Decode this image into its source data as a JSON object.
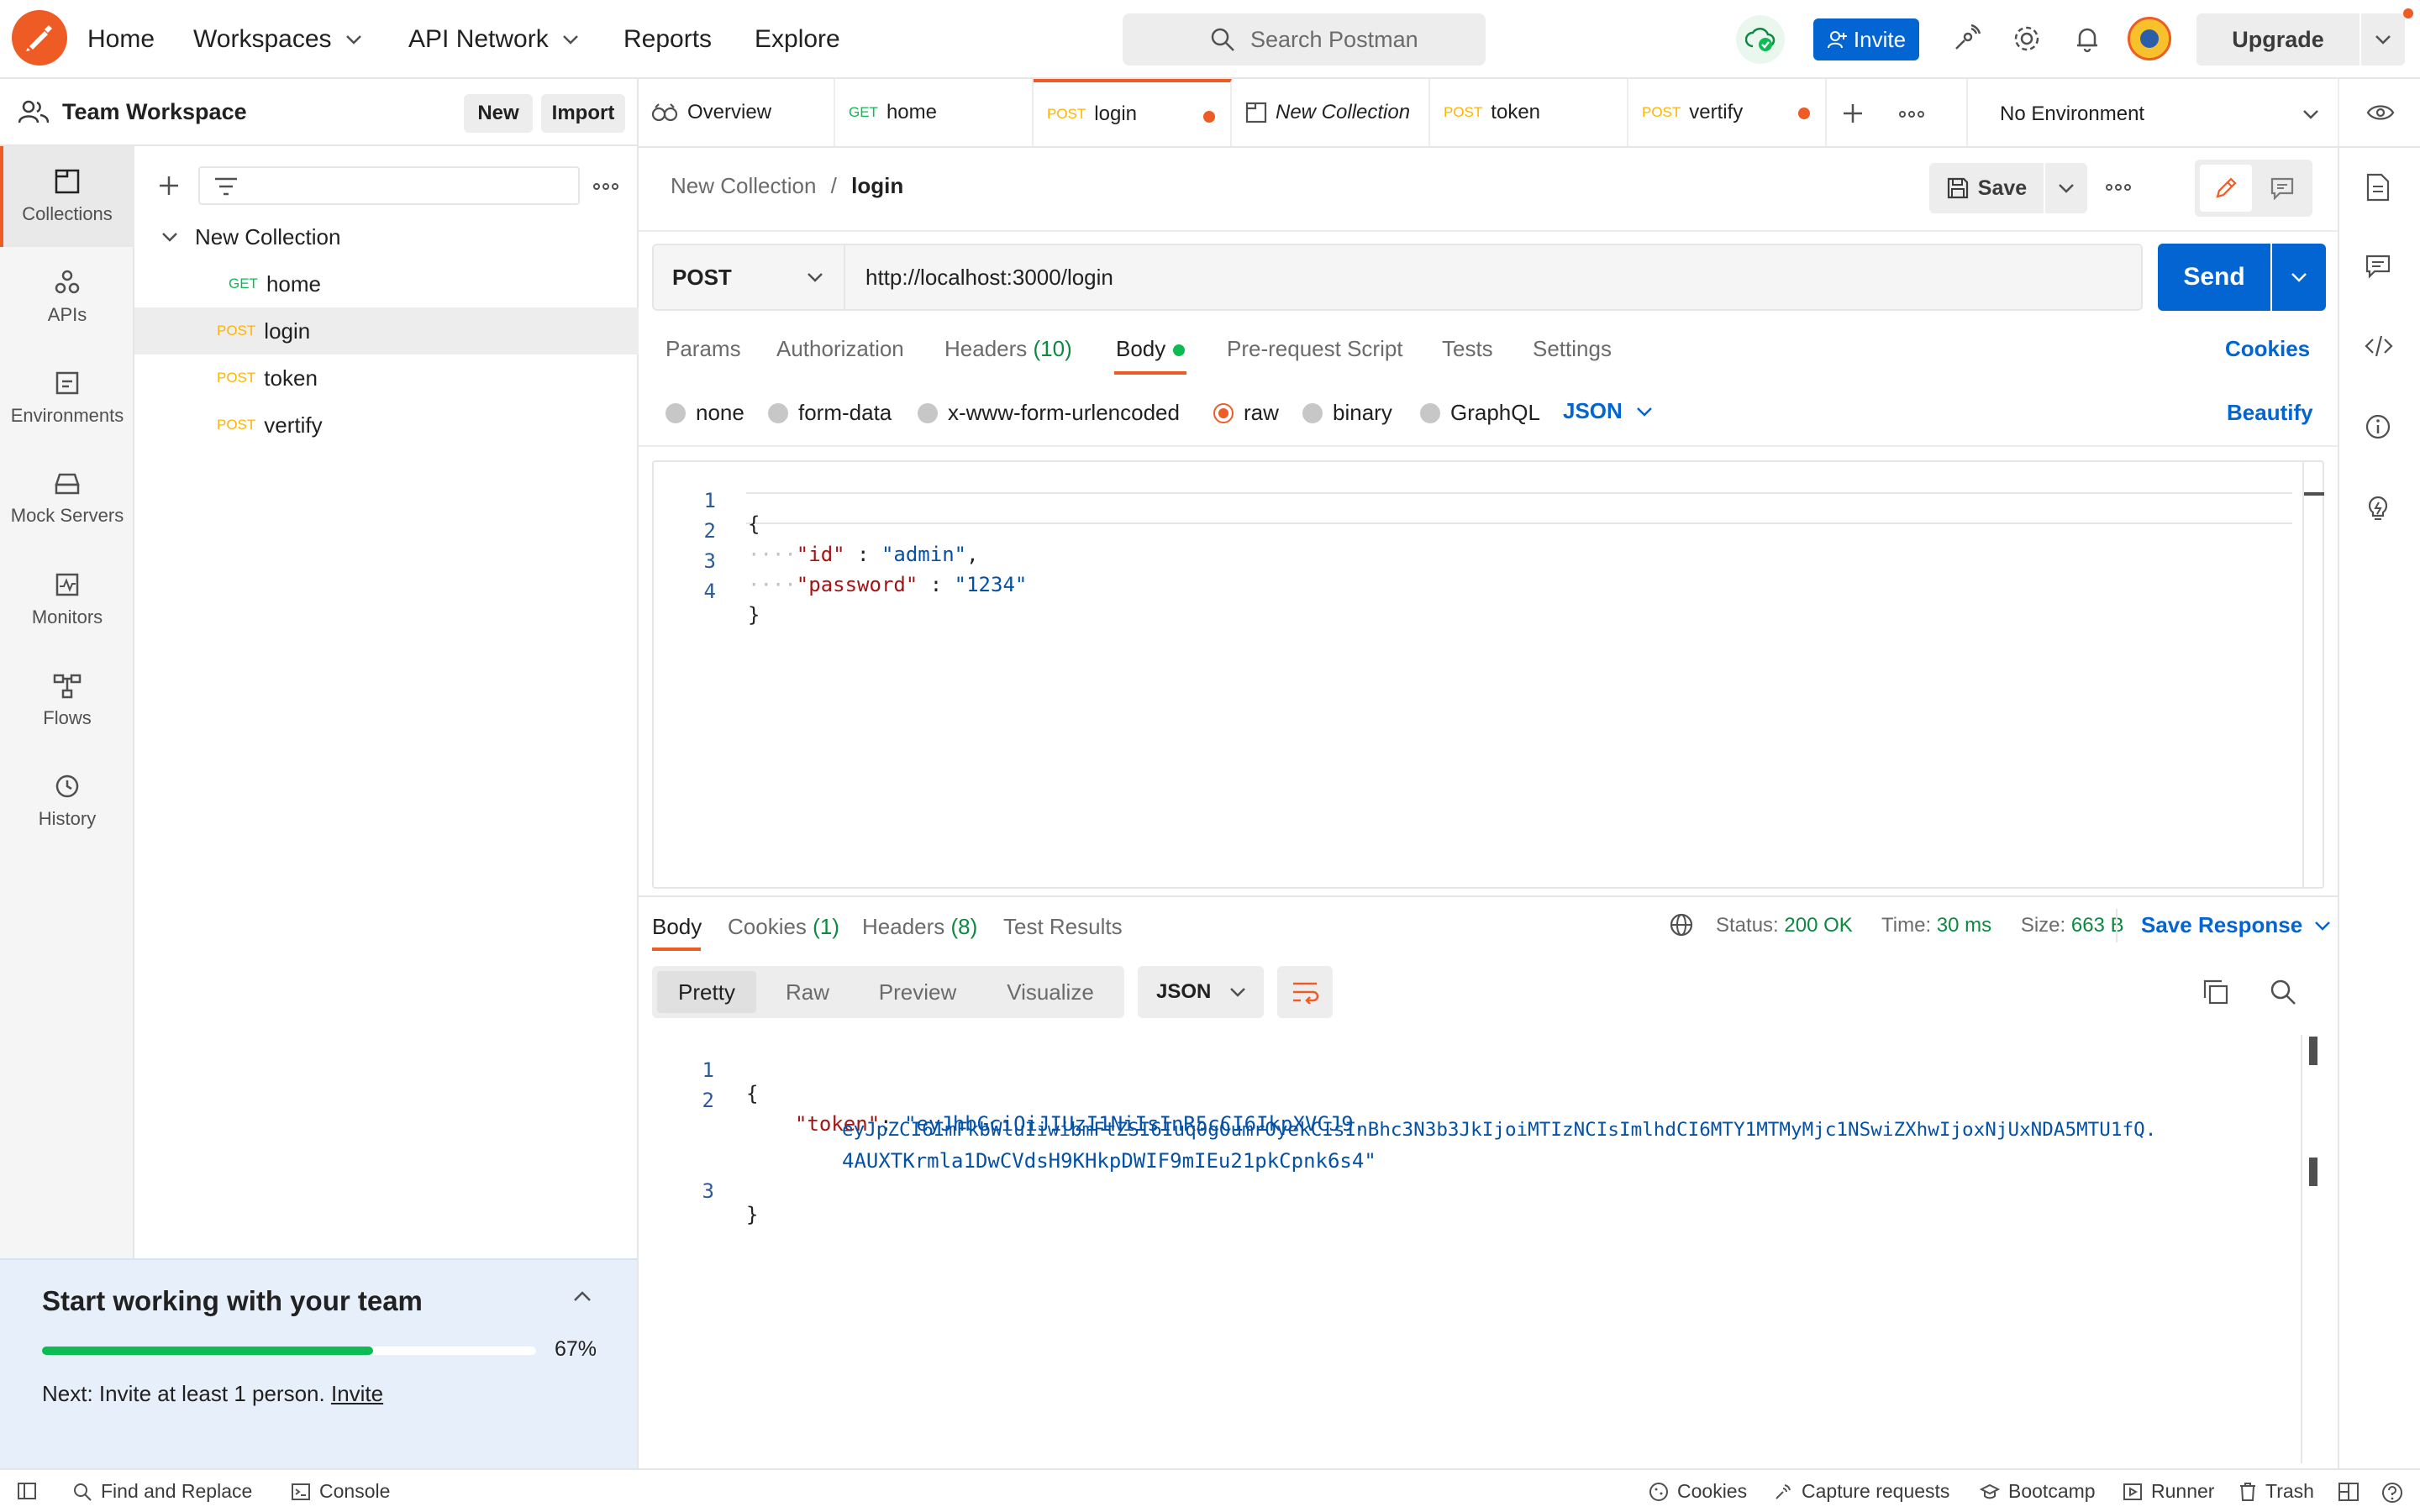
{
  "app": {
    "brand_color": "#ef5b25",
    "accent_color": "#0265d2",
    "success_color": "#0cbb52"
  },
  "topbar": {
    "nav": [
      {
        "label": "Home",
        "has_dropdown": false
      },
      {
        "label": "Workspaces",
        "has_dropdown": true
      },
      {
        "label": "API Network",
        "has_dropdown": true
      },
      {
        "label": "Reports",
        "has_dropdown": false
      },
      {
        "label": "Explore",
        "has_dropdown": false
      }
    ],
    "search_placeholder": "Search Postman",
    "invite_label": "Invite",
    "upgrade_label": "Upgrade",
    "icons": [
      "cloud-sync-icon",
      "satellite-icon",
      "gear-icon",
      "bell-icon",
      "avatar"
    ]
  },
  "workspace": {
    "title": "Team Workspace",
    "new_label": "New",
    "import_label": "Import"
  },
  "rail": {
    "items": [
      {
        "label": "Collections",
        "icon": "collections-icon",
        "active": true
      },
      {
        "label": "APIs",
        "icon": "apis-icon",
        "active": false
      },
      {
        "label": "Environments",
        "icon": "environments-icon",
        "active": false
      },
      {
        "label": "Mock Servers",
        "icon": "mock-servers-icon",
        "active": false
      },
      {
        "label": "Monitors",
        "icon": "monitors-icon",
        "active": false
      },
      {
        "label": "Flows",
        "icon": "flows-icon",
        "active": false
      },
      {
        "label": "History",
        "icon": "history-icon",
        "active": false
      }
    ]
  },
  "sidebar": {
    "collection_name": "New Collection",
    "requests": [
      {
        "method": "GET",
        "name": "home",
        "active": false
      },
      {
        "method": "POST",
        "name": "login",
        "active": true
      },
      {
        "method": "POST",
        "name": "token",
        "active": false
      },
      {
        "method": "POST",
        "name": "vertify",
        "active": false
      }
    ]
  },
  "onboarding": {
    "title": "Start working with your team",
    "progress_percent": 67,
    "progress_label": "67%",
    "next_text": "Next: Invite at least 1 person.",
    "next_link": "Invite"
  },
  "tabs": {
    "items": [
      {
        "method": "",
        "label": "Overview",
        "icon": "overview-icon",
        "unsaved": false,
        "active": false,
        "italic": false
      },
      {
        "method": "GET",
        "label": "home",
        "unsaved": false,
        "active": false,
        "italic": false
      },
      {
        "method": "POST",
        "label": "login",
        "unsaved": true,
        "active": true,
        "italic": false
      },
      {
        "method": "",
        "label": "New Collection",
        "icon": "collection-icon",
        "unsaved": false,
        "active": false,
        "italic": true
      },
      {
        "method": "POST",
        "label": "token",
        "unsaved": false,
        "active": false,
        "italic": false
      },
      {
        "method": "POST",
        "label": "vertify",
        "unsaved": true,
        "active": false,
        "italic": false
      }
    ],
    "environment": "No Environment"
  },
  "request": {
    "breadcrumb_parent": "New Collection",
    "breadcrumb_sep": "/",
    "breadcrumb_current": "login",
    "save_label": "Save",
    "method": "POST",
    "url": "http://localhost:3000/login",
    "send_label": "Send",
    "tabs": [
      {
        "label": "Params",
        "count": ""
      },
      {
        "label": "Authorization",
        "count": ""
      },
      {
        "label": "Headers",
        "count": "(10)"
      },
      {
        "label": "Body",
        "count": ""
      },
      {
        "label": "Pre-request Script",
        "count": ""
      },
      {
        "label": "Tests",
        "count": ""
      },
      {
        "label": "Settings",
        "count": ""
      }
    ],
    "active_tab": "Body",
    "cookies_label": "Cookies",
    "body_types": [
      "none",
      "form-data",
      "x-www-form-urlencoded",
      "raw",
      "binary",
      "GraphQL"
    ],
    "selected_body_type": "raw",
    "raw_format": "JSON",
    "beautify_label": "Beautify",
    "body_lines": [
      {
        "num": "1",
        "indent": "",
        "key": "",
        "sep": "",
        "value": "",
        "tail": "{"
      },
      {
        "num": "2",
        "indent": "····",
        "key": "\"id\"",
        "sep": " : ",
        "value": "\"admin\"",
        "tail": ","
      },
      {
        "num": "3",
        "indent": "····",
        "key": "\"password\"",
        "sep": " : ",
        "value": "\"1234\"",
        "tail": ""
      },
      {
        "num": "4",
        "indent": "",
        "key": "",
        "sep": "",
        "value": "",
        "tail": "}"
      }
    ]
  },
  "response": {
    "tabs": [
      {
        "label": "Body",
        "count": ""
      },
      {
        "label": "Cookies",
        "count": "(1)"
      },
      {
        "label": "Headers",
        "count": "(8)"
      },
      {
        "label": "Test Results",
        "count": ""
      }
    ],
    "status_label": "Status:",
    "status_value": "200 OK",
    "time_label": "Time:",
    "time_value": "30 ms",
    "size_label": "Size:",
    "size_value": "663 B",
    "save_response_label": "Save Response",
    "views": [
      "Pretty",
      "Raw",
      "Preview",
      "Visualize"
    ],
    "active_view": "Pretty",
    "format": "JSON",
    "body": {
      "line1_num": "1",
      "line1": "{",
      "line2_num": "2",
      "key": "\"token\"",
      "colon": ": ",
      "value_part1": "\"eyJhbGciOiJIUzI1NiIsInR5cCI6IkpXVCJ9.",
      "value_part2": "eyJpZCI6ImFkbWluIiwibmFtZSI6Iuq0gOumrOyekCIsInBhc3N3b3JkIjoiMTIzNCIsImlhdCI6MTY1MTMyMjc1NSwiZXhwIjoxNjUxNDA5MTU1fQ.",
      "value_part3": "4AUXTKrmla1DwCVdsH9KHkpDWIF9mIEu21pkCpnk6s4\"",
      "line3_num": "3",
      "line3": "}"
    }
  },
  "footer": {
    "find_replace": "Find and Replace",
    "console": "Console",
    "cookies": "Cookies",
    "capture": "Capture requests",
    "bootcamp": "Bootcamp",
    "runner": "Runner",
    "trash": "Trash"
  }
}
